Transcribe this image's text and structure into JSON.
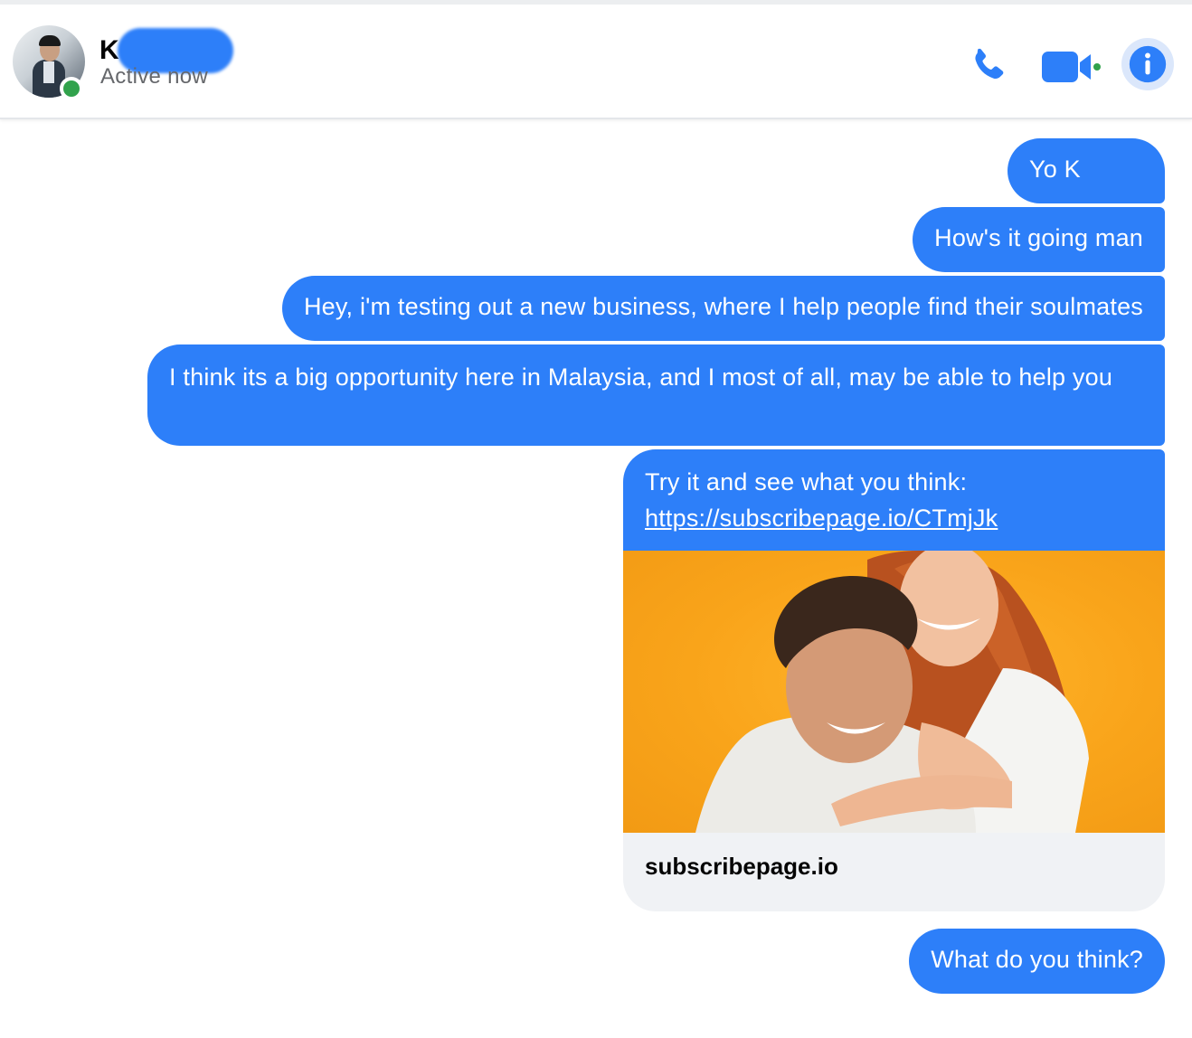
{
  "header": {
    "contact_name": "K e",
    "status": "Active now",
    "actions": {
      "call": "phone-icon",
      "video": "video-camera-icon",
      "info": "info-icon"
    }
  },
  "messages": [
    {
      "text": "Yo K"
    },
    {
      "text": "How's it going man"
    },
    {
      "text": "Hey, i'm testing out a new business, where I help people find their soulmates"
    },
    {
      "text": "I think its a big opportunity here in Malaysia, and I most of all, may be able to help you"
    },
    {
      "text": "Try it and see what you think:",
      "link": "https://subscribepage.io/CTmjJk",
      "preview_domain": "subscribepage.io"
    },
    {
      "text": "What do you think?"
    }
  ],
  "colors": {
    "bubble": "#2d7ff9",
    "online": "#31a24c",
    "preview_bg": "#f0f2f5",
    "image_bg": "#f9a41a"
  }
}
